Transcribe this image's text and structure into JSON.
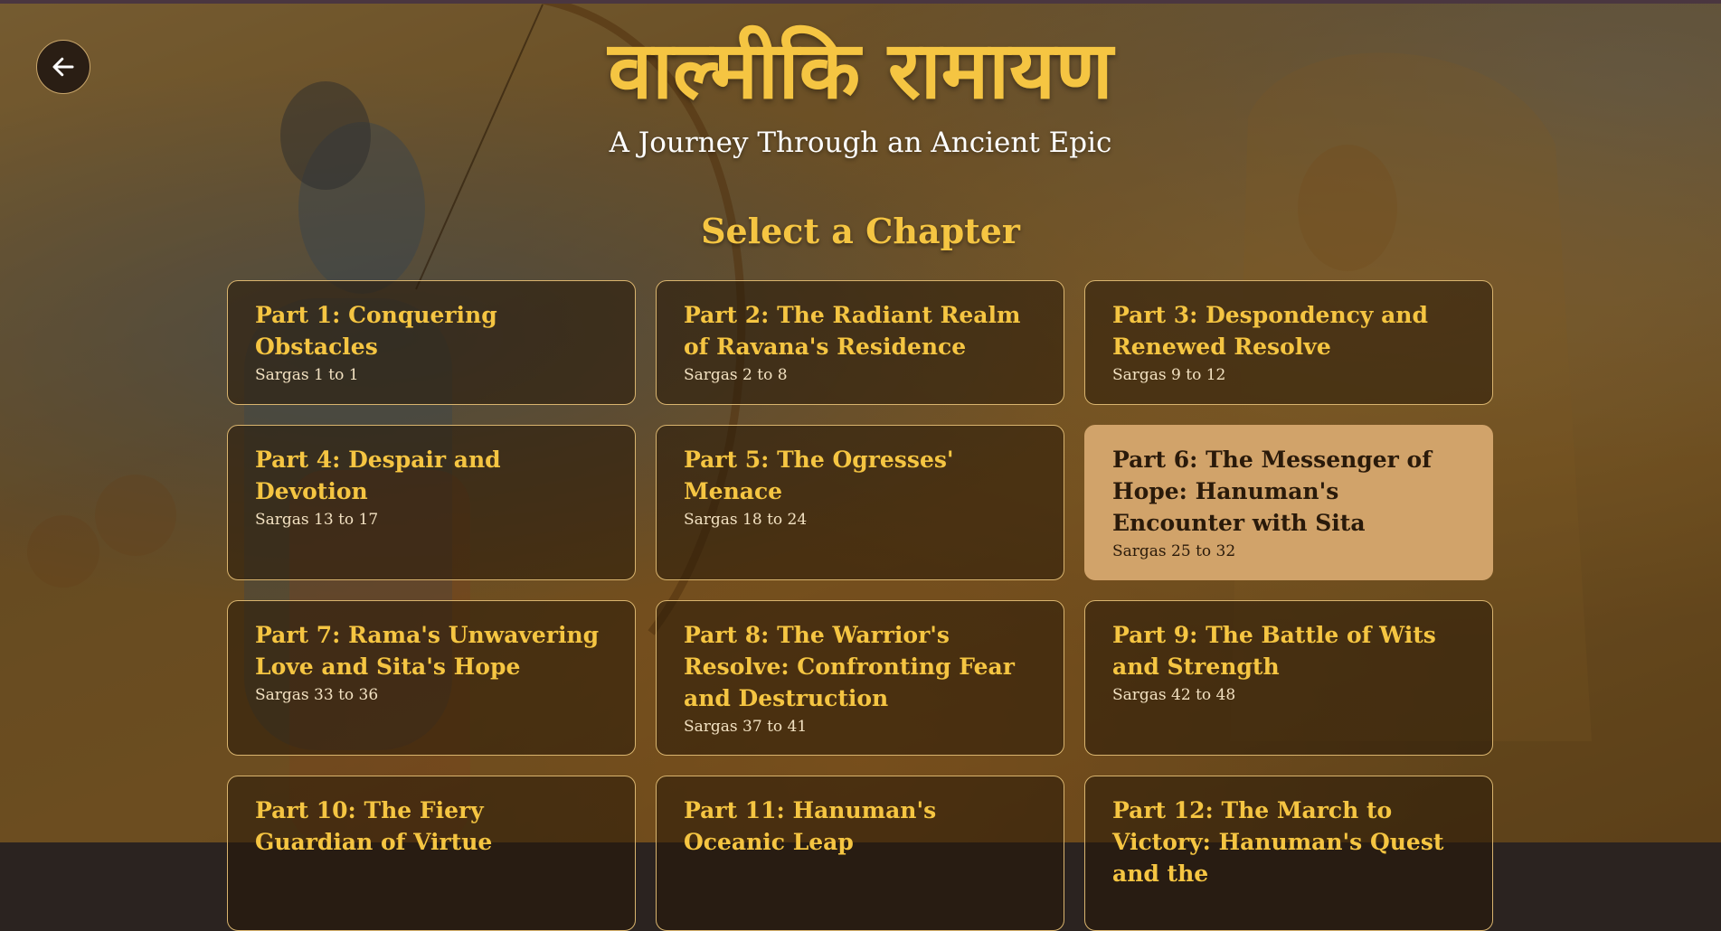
{
  "header": {
    "title": "वाल्मीकि रामायण",
    "subtitle": "A Journey Through an Ancient Epic",
    "back_icon": "arrow-left-icon"
  },
  "section_heading": "Select a Chapter",
  "selected_chapter": 6,
  "colors": {
    "accent_gold": "#f5c542",
    "card_border": "#d9b46e",
    "card_active_bg": "#d1a36a",
    "back_button_bg": "#2a1e14"
  },
  "chapters": [
    {
      "title": "Part 1: Conquering Obstacles",
      "range": "Sargas 1 to 1"
    },
    {
      "title": "Part 2: The Radiant Realm of Ravana's Residence",
      "range": "Sargas 2 to 8"
    },
    {
      "title": "Part 3: Despondency and Renewed Resolve",
      "range": "Sargas 9 to 12"
    },
    {
      "title": "Part 4: Despair and Devotion",
      "range": "Sargas 13 to 17"
    },
    {
      "title": "Part 5: The Ogresses' Menace",
      "range": "Sargas 18 to 24"
    },
    {
      "title": "Part 6: The Messenger of Hope: Hanuman's Encounter with Sita",
      "range": "Sargas 25 to 32"
    },
    {
      "title": "Part 7: Rama's Unwavering Love and Sita's Hope",
      "range": "Sargas 33 to 36"
    },
    {
      "title": "Part 8: The Warrior's Resolve: Confronting Fear and Destruction",
      "range": "Sargas 37 to 41"
    },
    {
      "title": "Part 9: The Battle of Wits and Strength",
      "range": "Sargas 42 to 48"
    },
    {
      "title": "Part 10: The Fiery Guardian of Virtue",
      "range": ""
    },
    {
      "title": "Part 11: Hanuman's Oceanic Leap",
      "range": ""
    },
    {
      "title": "Part 12: The March to Victory: Hanuman's Quest and the",
      "range": ""
    }
  ]
}
